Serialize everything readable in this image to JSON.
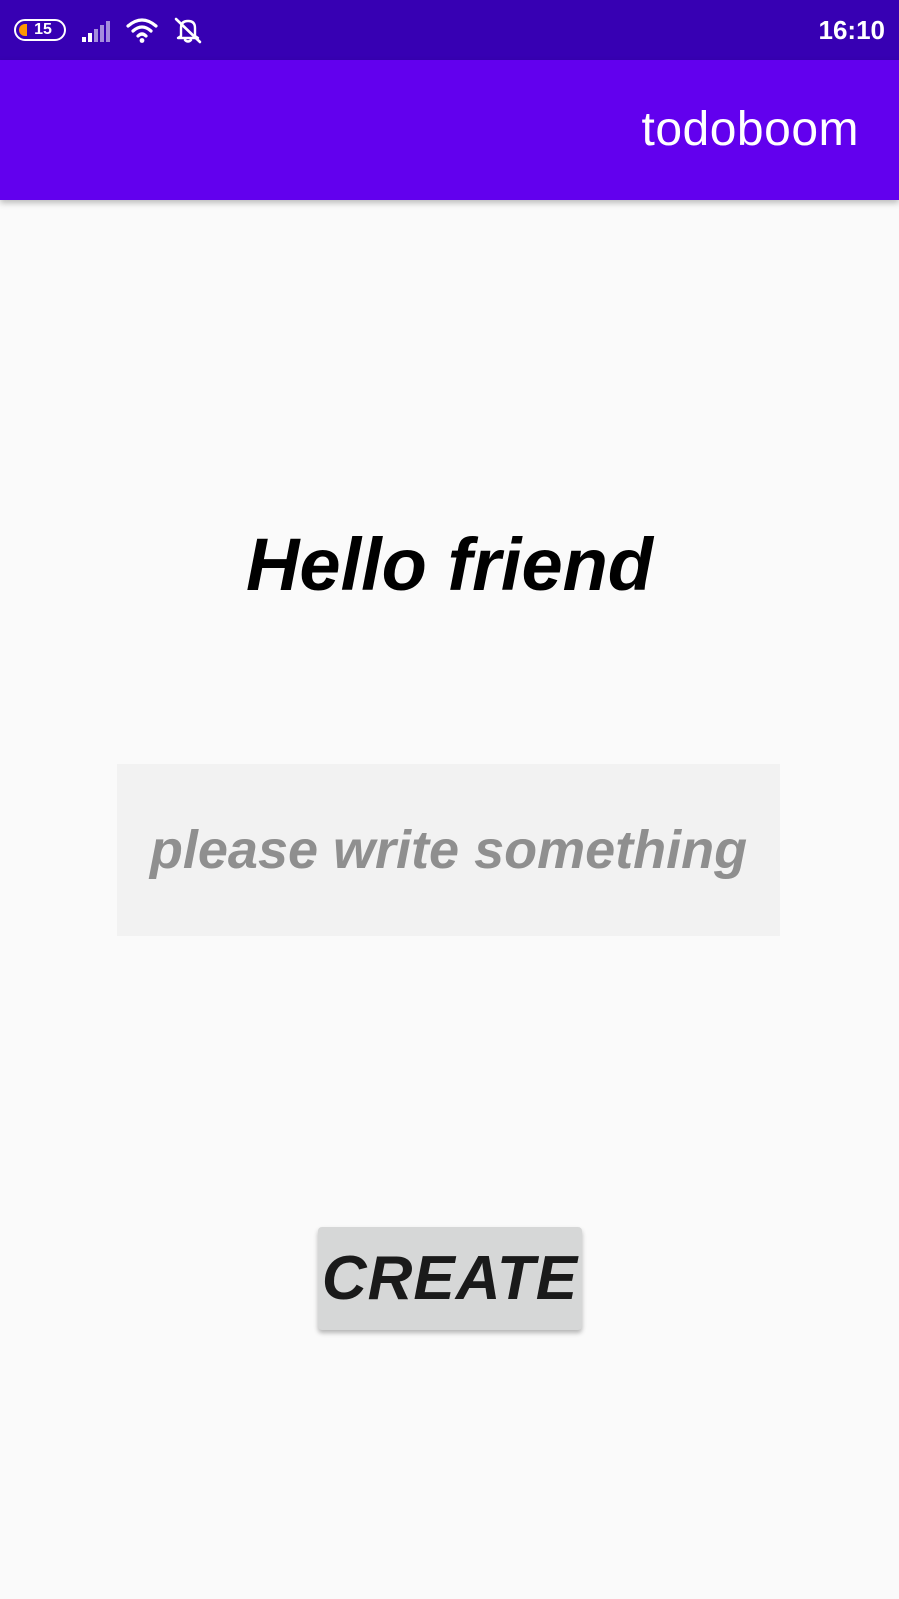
{
  "status_bar": {
    "battery_level": "15",
    "time": "16:10",
    "icons": [
      "signal-icon",
      "wifi-icon",
      "alarm-off-icon"
    ],
    "colors": {
      "background": "#3700B3",
      "battery_low": "#FF9800"
    }
  },
  "app_bar": {
    "title": "todoboom",
    "color": "#6200EE"
  },
  "main": {
    "greeting": "Hello friend",
    "input": {
      "value": "",
      "placeholder": "please write something"
    },
    "create_label": "CREATE"
  }
}
